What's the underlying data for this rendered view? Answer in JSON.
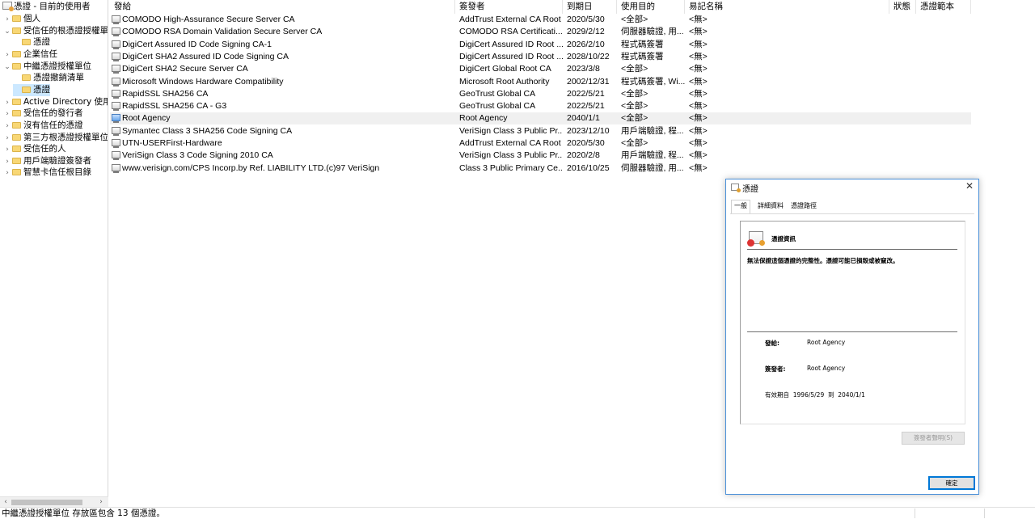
{
  "tree": {
    "nodes": [
      {
        "label": "憑證 - 目前的使用者",
        "toggle": "",
        "kind": "root"
      },
      {
        "label": "個人",
        "toggle": "›",
        "kind": "folder"
      },
      {
        "label": "受信任的根憑證授權單位",
        "toggle": "⌄",
        "kind": "folder"
      },
      {
        "label": "憑證",
        "toggle": "",
        "kind": "folder"
      },
      {
        "label": "企業信任",
        "toggle": "›",
        "kind": "folder"
      },
      {
        "label": "中繼憑證授權單位",
        "toggle": "⌄",
        "kind": "folder"
      },
      {
        "label": "憑證撤銷清單",
        "toggle": "",
        "kind": "folder"
      },
      {
        "label": "憑證",
        "toggle": "",
        "kind": "folder"
      },
      {
        "label": "Active Directory 使用者",
        "toggle": "›",
        "kind": "folder"
      },
      {
        "label": "受信任的發行者",
        "toggle": "›",
        "kind": "folder"
      },
      {
        "label": "沒有信任的憑證",
        "toggle": "›",
        "kind": "folder"
      },
      {
        "label": "第三方根憑證授權單位",
        "toggle": "›",
        "kind": "folder"
      },
      {
        "label": "受信任的人",
        "toggle": "›",
        "kind": "folder"
      },
      {
        "label": "用戶端驗證簽發者",
        "toggle": "›",
        "kind": "folder"
      },
      {
        "label": "智慧卡信任根目錄",
        "toggle": "›",
        "kind": "folder"
      }
    ],
    "scroll_left": "‹",
    "scroll_right": "›"
  },
  "list": {
    "columns": [
      "發給",
      "簽發者",
      "到期日",
      "使用目的",
      "易記名稱",
      "狀態",
      "憑證範本"
    ],
    "sort_indicator": "^",
    "rows": [
      [
        "COMODO High-Assurance Secure Server CA",
        "AddTrust External CA Root",
        "2020/5/30",
        "<全部>",
        "<無>"
      ],
      [
        "COMODO RSA Domain Validation Secure Server CA",
        "COMODO RSA Certificati...",
        "2029/2/12",
        "伺服器驗證, 用...",
        "<無>"
      ],
      [
        "DigiCert Assured ID Code Signing CA-1",
        "DigiCert Assured ID Root ...",
        "2026/2/10",
        "程式碼簽署",
        "<無>"
      ],
      [
        "DigiCert SHA2 Assured ID Code Signing CA",
        "DigiCert Assured ID Root ...",
        "2028/10/22",
        "程式碼簽署",
        "<無>"
      ],
      [
        "DigiCert SHA2 Secure Server CA",
        "DigiCert Global Root CA",
        "2023/3/8",
        "<全部>",
        "<無>"
      ],
      [
        "Microsoft Windows Hardware Compatibility",
        "Microsoft Root Authority",
        "2002/12/31",
        "程式碼簽署, Wi...",
        "<無>"
      ],
      [
        "RapidSSL SHA256 CA",
        "GeoTrust Global CA",
        "2022/5/21",
        "<全部>",
        "<無>"
      ],
      [
        "RapidSSL SHA256 CA - G3",
        "GeoTrust Global CA",
        "2022/5/21",
        "<全部>",
        "<無>"
      ],
      [
        "Root Agency",
        "Root Agency",
        "2040/1/1",
        "<全部>",
        "<無>"
      ],
      [
        "Symantec Class 3 SHA256 Code Signing CA",
        "VeriSign Class 3 Public Pr...",
        "2023/12/10",
        "用戶端驗證, 程...",
        "<無>"
      ],
      [
        "UTN-USERFirst-Hardware",
        "AddTrust External CA Root",
        "2020/5/30",
        "<全部>",
        "<無>"
      ],
      [
        "VeriSign Class 3 Code Signing 2010 CA",
        "VeriSign Class 3 Public Pr...",
        "2020/2/8",
        "用戶端驗證, 程...",
        "<無>"
      ],
      [
        "www.verisign.com/CPS Incorp.by Ref. LIABILITY LTD.(c)97 VeriSign",
        "Class 3 Public Primary Ce...",
        "2016/10/25",
        "伺服器驗證, 用...",
        "<無>"
      ]
    ]
  },
  "status": {
    "text": "中繼憑證授權單位 存放區包含 13 個憑證。"
  },
  "dialog": {
    "title": "憑證",
    "close": "✕",
    "tabs": [
      "一般",
      "詳細資料",
      "憑證路徑"
    ],
    "info_title": "憑證資訊",
    "warning": "無法保證這個憑證的完整性。憑證可能已損毀或被竄改。",
    "issued_to_label": "發給:",
    "issued_to_value": "Root Agency",
    "issued_by_label": "簽發者:",
    "issued_by_value": "Root Agency",
    "validity": "有效期自  1996/5/29  到  2040/1/1",
    "issuer_statement_button": "簽發者聲明(S)",
    "ok_button": "確定"
  },
  "colors": {
    "selection": "#cce8ff",
    "hover_row": "#f0f0f0",
    "folder": "#f8d775",
    "dialog_border": "#4a90d9"
  }
}
